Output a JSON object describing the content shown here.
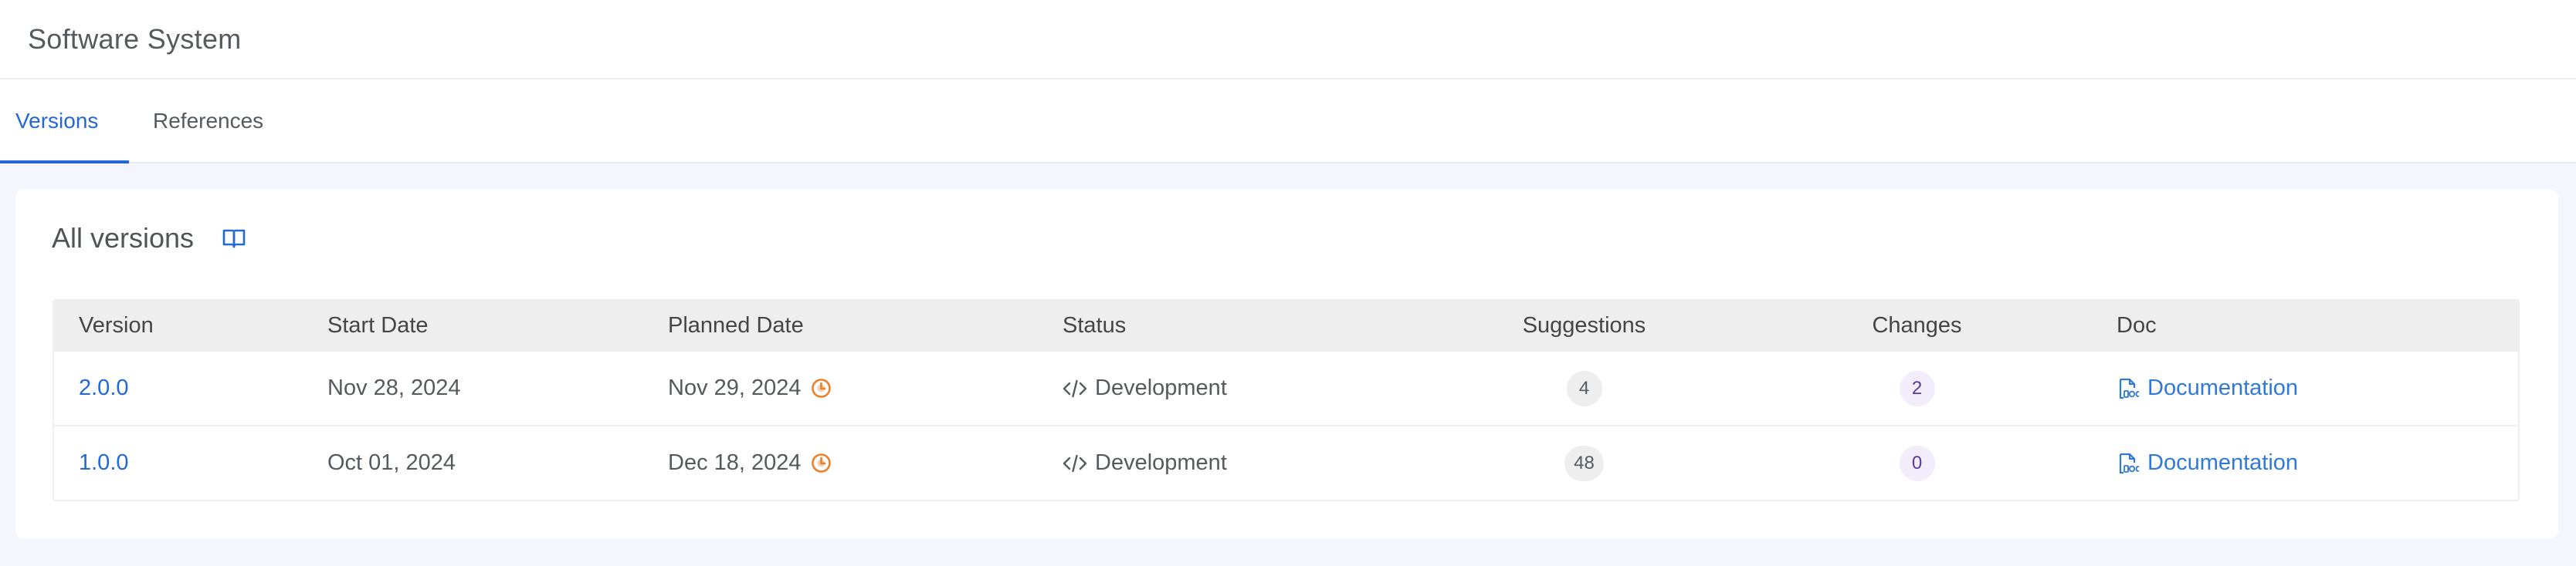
{
  "header": {
    "title": "Software System"
  },
  "tabs": [
    {
      "label": "Versions",
      "active": true
    },
    {
      "label": "References",
      "active": false
    }
  ],
  "section": {
    "title": "All versions",
    "icon": "book-open-icon"
  },
  "table": {
    "columns": [
      "Version",
      "Start Date",
      "Planned Date",
      "Status",
      "Suggestions",
      "Changes",
      "Doc"
    ],
    "rows": [
      {
        "version": "2.0.0",
        "start_date": "Nov 28, 2024",
        "planned_date": "Nov 29, 2024",
        "planned_icon": "clock-alert-icon",
        "status": "Development",
        "status_icon": "code-icon",
        "suggestions": "4",
        "changes": "2",
        "doc": "Documentation",
        "doc_icon": "document-icon"
      },
      {
        "version": "1.0.0",
        "start_date": "Oct 01, 2024",
        "planned_date": "Dec 18, 2024",
        "planned_icon": "clock-alert-icon",
        "status": "Development",
        "status_icon": "code-icon",
        "suggestions": "48",
        "changes": "0",
        "doc": "Documentation",
        "doc_icon": "document-icon"
      }
    ]
  },
  "colors": {
    "accent": "#2468d6",
    "link": "#2f7ad9",
    "warning": "#e8822a",
    "badge_purple_bg": "#f3ecfb"
  }
}
